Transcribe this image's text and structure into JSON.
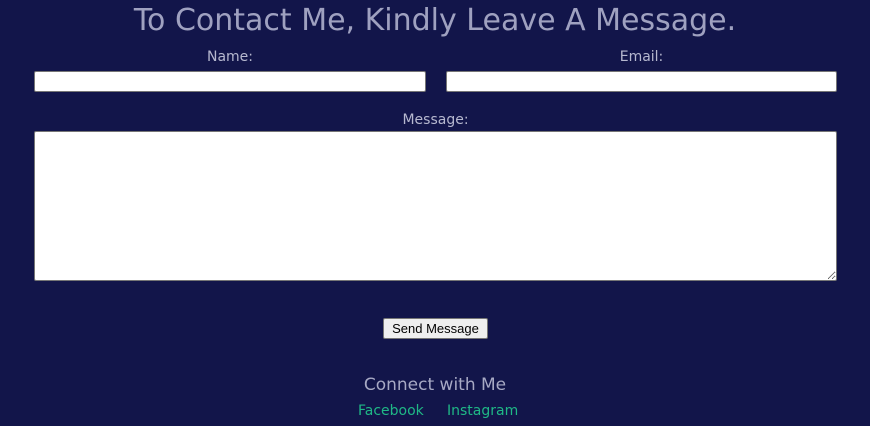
{
  "page": {
    "title": "To Contact Me, Kindly Leave A Message."
  },
  "form": {
    "name_label": "Name:",
    "name_value": "",
    "email_label": "Email:",
    "email_value": "",
    "message_label": "Message:",
    "message_value": "",
    "send_label": "Send Message"
  },
  "footer": {
    "connect_text": "Connect with Me",
    "links": [
      {
        "label": "Facebook"
      },
      {
        "label": "Instagram"
      }
    ],
    "link_color": "#1fb886"
  },
  "colors": {
    "background": "#12154a",
    "title": "#9fa1c0",
    "label": "#b6b8cf"
  }
}
